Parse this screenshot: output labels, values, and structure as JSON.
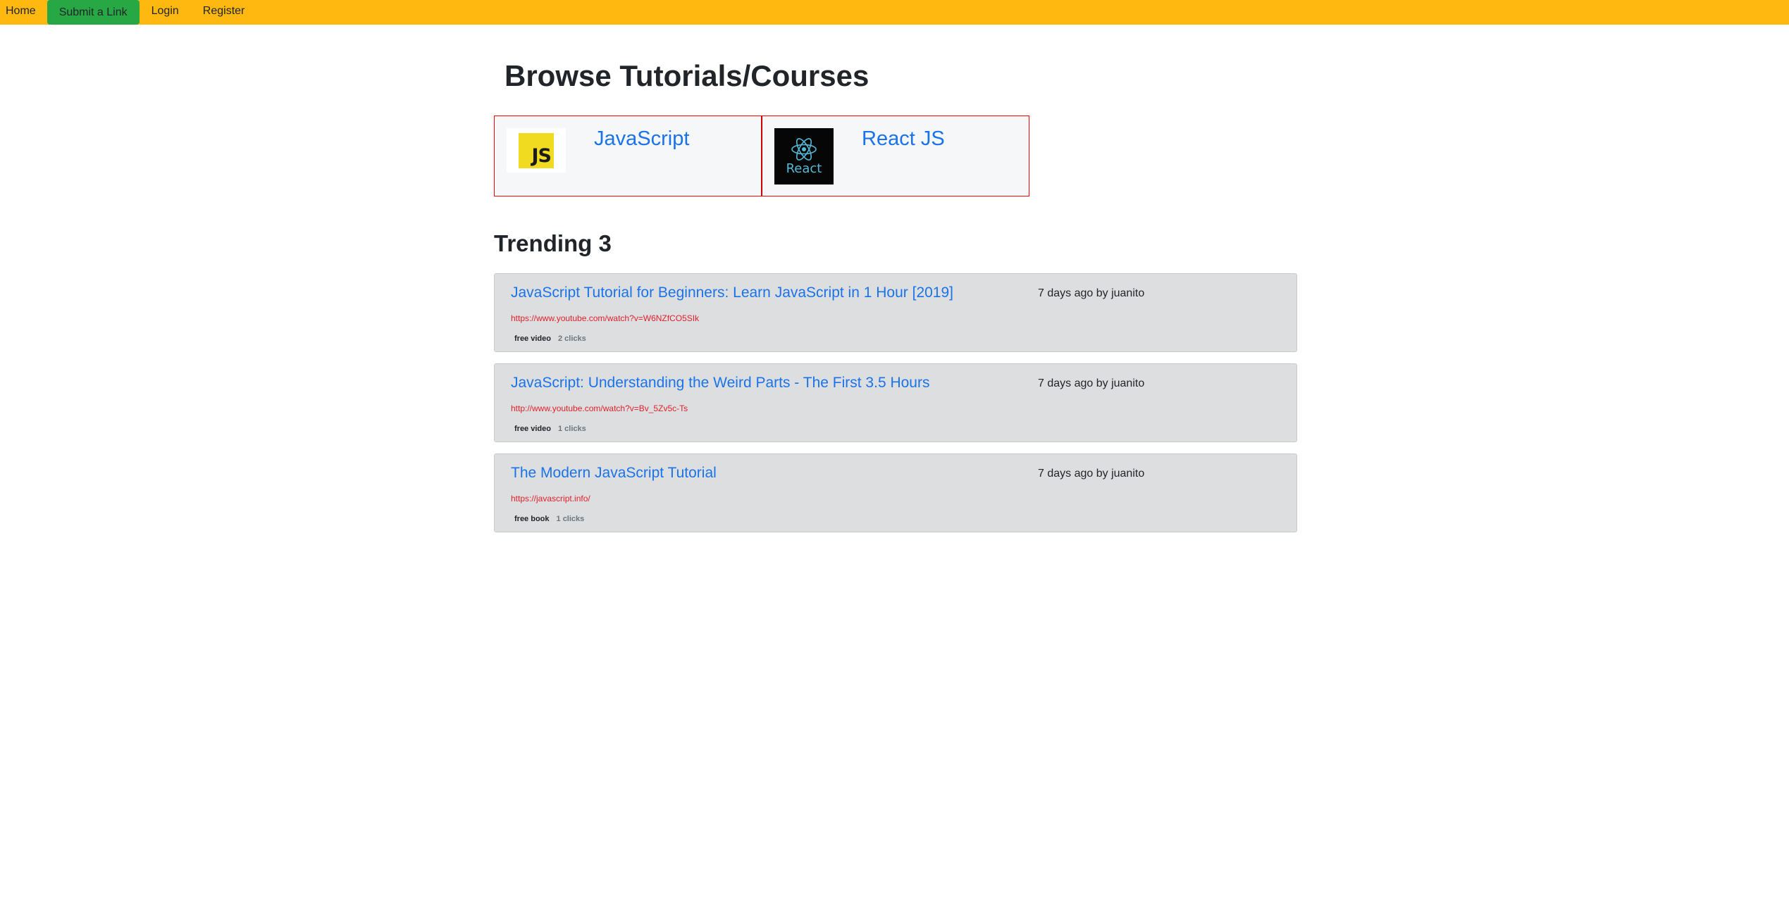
{
  "nav": {
    "home": "Home",
    "submit": "Submit a Link",
    "login": "Login",
    "register": "Register"
  },
  "page_title": "Browse Tutorials/Courses",
  "categories": [
    {
      "name": "JavaScript",
      "logo_text": "JS",
      "icon": "javascript-logo-icon"
    },
    {
      "name": "React JS",
      "logo_text": "React",
      "icon": "react-logo-icon"
    }
  ],
  "trending": {
    "title": "Trending 3",
    "items": [
      {
        "title": "JavaScript Tutorial for Beginners: Learn JavaScript in 1 Hour [2019]",
        "meta": "7 days ago by juanito",
        "url": "https://www.youtube.com/watch?v=W6NZfCO5SIk",
        "type": "free video",
        "clicks": "2 clicks"
      },
      {
        "title": "JavaScript: Understanding the Weird Parts - The First 3.5 Hours",
        "meta": "7 days ago by juanito",
        "url": "http://www.youtube.com/watch?v=Bv_5Zv5c-Ts",
        "type": "free video",
        "clicks": "1 clicks"
      },
      {
        "title": "The Modern JavaScript Tutorial",
        "meta": "7 days ago by juanito",
        "url": "https://javascript.info/",
        "type": "free book",
        "clicks": "1 clicks"
      }
    ]
  },
  "colors": {
    "navbar": "#ffb810",
    "submit_button": "#28a745",
    "link": "#1a73e8",
    "url": "#e0202a",
    "card_border": "#ff0000"
  }
}
